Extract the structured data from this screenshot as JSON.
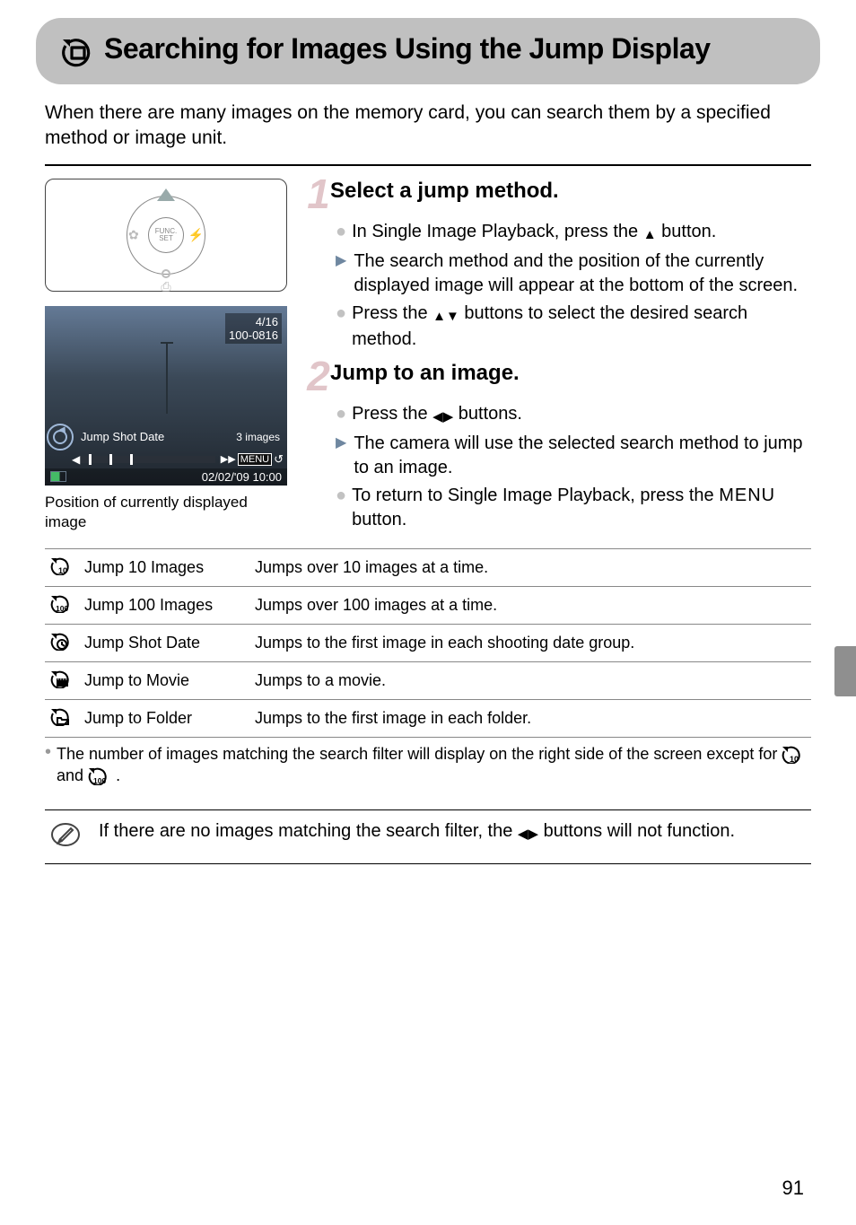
{
  "header": {
    "title": "Searching for Images Using the Jump Display"
  },
  "intro": "When there are many images on the memory card, you can search them by a specified method or image unit.",
  "dpad": {
    "center": "FUNC.\nSET"
  },
  "screenshot": {
    "counter": "4/16",
    "file_no": "100-0816",
    "mode_label": "Jump Shot Date",
    "count_label": "3 images",
    "skip_label": "▶▶",
    "menu_label": "MENU",
    "undo_glyph": "↺",
    "datetime": "02/02/'09 10:00"
  },
  "caption": "Position of currently displayed image",
  "steps": {
    "s1": {
      "num": "1",
      "title": "Select a jump method.",
      "b1a": "In Single Image Playback, press the ",
      "b1b": " button.",
      "b2": "The search method and the position of the currently displayed image will appear at the bottom of the screen.",
      "b3a": "Press the ",
      "b3b": " buttons to select the desired search method."
    },
    "s2": {
      "num": "2",
      "title": "Jump to an image.",
      "b1a": "Press the ",
      "b1b": " buttons.",
      "b2": "The camera will use the selected search method to jump to an image.",
      "b3a": "To return to Single Image Playback, press the ",
      "b3b": " button."
    }
  },
  "menu_word": "MENU",
  "table": {
    "r1": {
      "name": "Jump 10 Images",
      "desc": "Jumps over 10 images at a time."
    },
    "r2": {
      "name": "Jump 100 Images",
      "desc": "Jumps over 100 images at a time."
    },
    "r3": {
      "name": "Jump Shot Date",
      "desc": "Jumps to the first image in each shooting date group."
    },
    "r4": {
      "name": "Jump to Movie",
      "desc": "Jumps to a movie."
    },
    "r5": {
      "name": "Jump to Folder",
      "desc": "Jumps to the first image in each folder."
    }
  },
  "footnote_a": "The number of images matching the search filter will display on the right side of the screen except for ",
  "footnote_b": " and ",
  "footnote_c": ".",
  "note": {
    "a": "If there are no images matching the search filter, the ",
    "b": " buttons will not function."
  },
  "page_number": "91"
}
